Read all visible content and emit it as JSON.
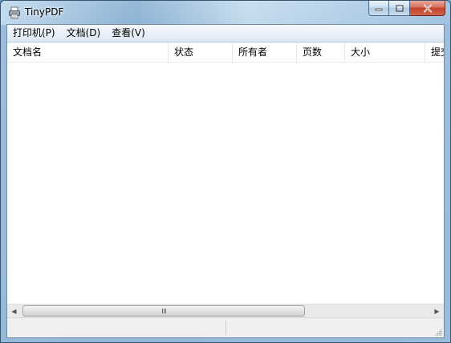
{
  "window": {
    "title": "TinyPDF",
    "icon": "printer-icon",
    "controls": {
      "minimize": "minimize-icon",
      "maximize": "maximize-icon",
      "close": "close-icon"
    }
  },
  "menubar": {
    "items": [
      {
        "label": "打印机(P)"
      },
      {
        "label": "文档(D)"
      },
      {
        "label": "查看(V)"
      }
    ]
  },
  "list": {
    "columns": [
      {
        "label": "文档名"
      },
      {
        "label": "状态"
      },
      {
        "label": "所有者"
      },
      {
        "label": "页数"
      },
      {
        "label": "大小"
      },
      {
        "label": "提交"
      }
    ],
    "rows": []
  },
  "scrollbar": {
    "left_arrow": "◀",
    "right_arrow": "▶"
  },
  "colors": {
    "titlebar": "#a9c7e4",
    "close_button": "#c2432a",
    "client_bg": "#ffffff",
    "menubar_bg": "#e6eef8"
  }
}
